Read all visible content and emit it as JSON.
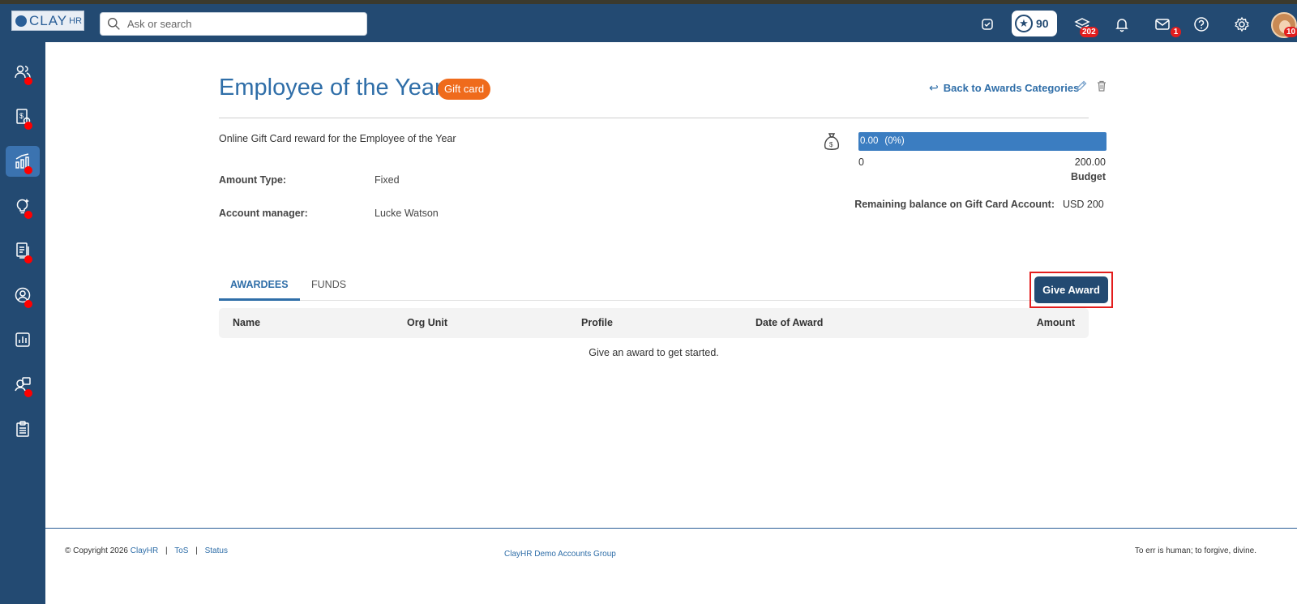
{
  "header": {
    "logo_text": "CLAY",
    "logo_suffix": "HR",
    "search_placeholder": "Ask or search",
    "points": "90",
    "layers_badge": "202",
    "mail_badge": "1",
    "avatar_badge": "10"
  },
  "page": {
    "title": "Employee of the Year",
    "tag": "Gift card",
    "back_link": "Back to Awards Categories",
    "description": "Online Gift Card reward for the Employee of the Year",
    "amount_type_label": "Amount Type:",
    "amount_type_value": "Fixed",
    "account_manager_label": "Account manager:",
    "account_manager_value": "Lucke Watson"
  },
  "budget": {
    "used": "0.00",
    "used_pct": "(0%)",
    "min": "0",
    "max": "200.00",
    "label": "Budget",
    "remaining_label": "Remaining balance on Gift Card Account:",
    "remaining_value": "USD 200",
    "fill_fraction": 1.0
  },
  "tabs": {
    "awardees": "AWARDEES",
    "funds": "FUNDS"
  },
  "give_award_label": "Give Award",
  "table": {
    "columns": [
      "Name",
      "Org Unit",
      "Profile",
      "Date of Award",
      "Amount"
    ],
    "empty_text": "Give an award to get started."
  },
  "footer": {
    "copyright": "© Copyright 2026",
    "brand": "ClayHR",
    "tos": "ToS",
    "status": "Status",
    "sep": "|",
    "center": "ClayHR Demo Accounts Group",
    "quote": "To err is human; to forgive, divine."
  },
  "colors": {
    "primary": "#234a72",
    "accent": "#2f6ea8",
    "tag": "#ef6b1c",
    "alert": "#e31d1d"
  }
}
